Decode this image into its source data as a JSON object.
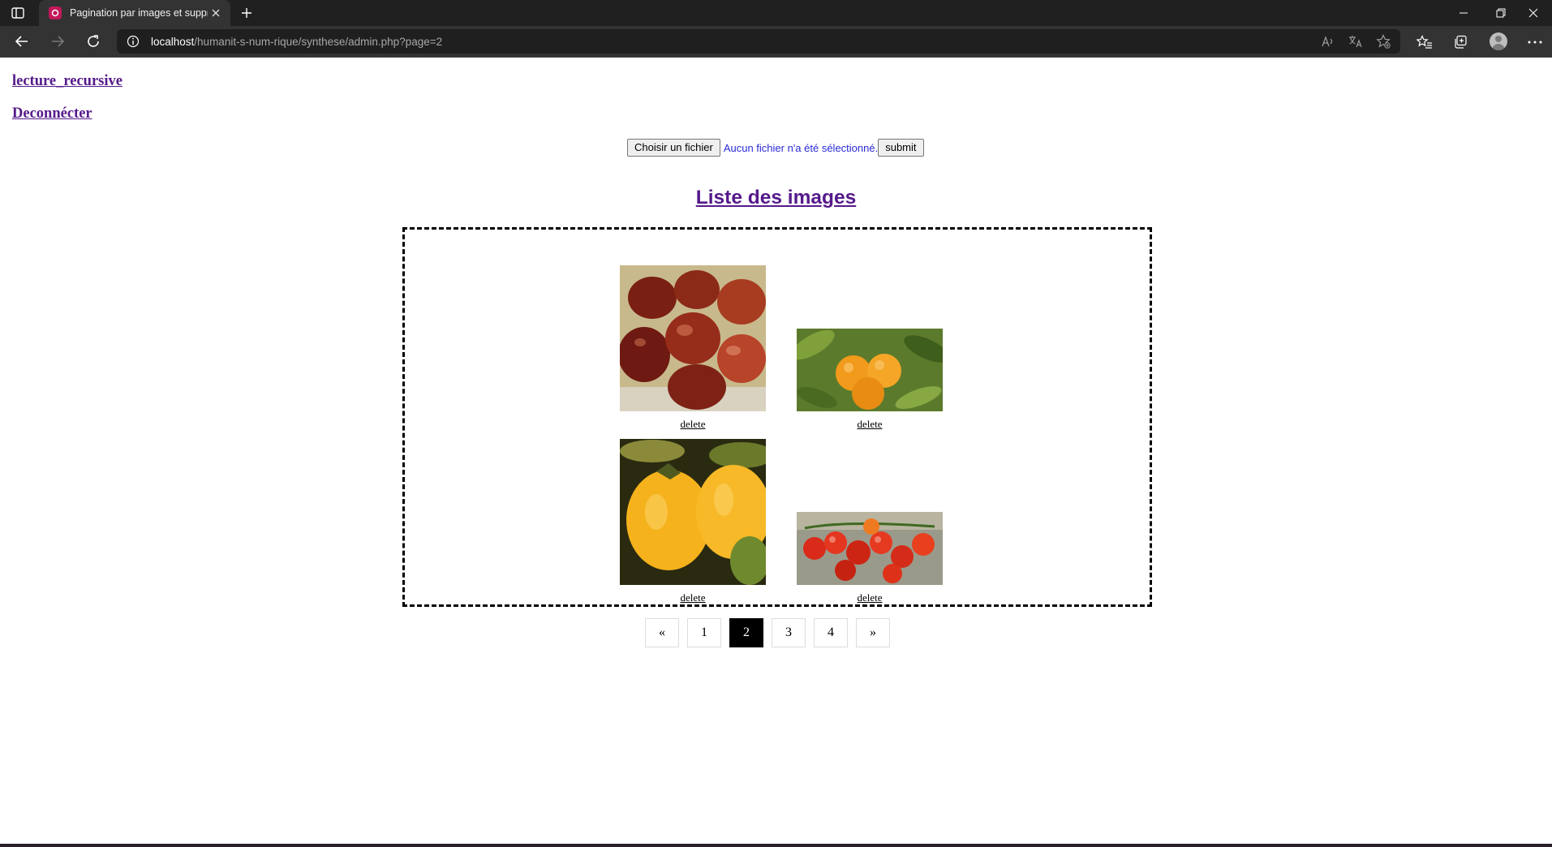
{
  "browser": {
    "tab_title": "Pagination par images et suppression",
    "url_host": "localhost",
    "url_path": "/humanit-s-num-rique/synthese/admin.php?page=2"
  },
  "page": {
    "links": [
      "lecture_recursive",
      "Deconnécter"
    ],
    "upload": {
      "choose_label": "Choisir un fichier",
      "no_file_text": "Aucun fichier n'a été sélectionné.",
      "submit_label": "submit"
    },
    "heading": "Liste des images",
    "gallery": [
      {
        "image": "red-jujube-fruit-photo",
        "delete_label": "delete"
      },
      {
        "image": "oranges-on-branch-photo",
        "delete_label": "delete"
      },
      {
        "image": "yellow-persimmons-photo",
        "delete_label": "delete"
      },
      {
        "image": "cherry-tomatoes-vine-photo",
        "delete_label": "delete"
      }
    ],
    "pagination": {
      "prev": "«",
      "pages": [
        "1",
        "2",
        "3",
        "4"
      ],
      "current": "2",
      "next": "»"
    }
  }
}
